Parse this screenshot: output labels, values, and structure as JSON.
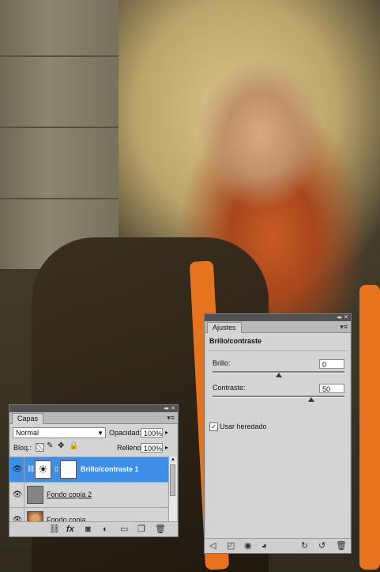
{
  "adjustments_panel": {
    "tab_label": "Ajustes",
    "title": "Brillo/contraste",
    "brightness_label": "Brillo:",
    "brightness_value": "0",
    "brightness_level": 0.5,
    "contrast_label": "Contraste:",
    "contrast_value": "50",
    "contrast_level": 0.75,
    "legacy_checkbox_label": "Usar heredado",
    "legacy_checked": true,
    "collapse_glyph": "◂◂",
    "close_glyph": "✕",
    "menu_glyph": "▾≡"
  },
  "layers_panel": {
    "tab_label": "Capas",
    "blend_mode": "Normal",
    "opacity_label": "Opacidad:",
    "opacity_value": "100%",
    "lock_label": "Bloq.:",
    "fill_label": "Relleno:",
    "fill_value": "100%",
    "layers": [
      {
        "name": "Brillo/contraste 1",
        "selected": true,
        "visible": true,
        "thumb": "brightness-adjustment"
      },
      {
        "name": "Fondo copia 2",
        "selected": false,
        "visible": true,
        "thumb": "gray-fill"
      },
      {
        "name": "Fondo copia",
        "selected": false,
        "visible": true,
        "thumb": "photo"
      }
    ],
    "bottom_icons": [
      "link-icon",
      "fx-icon",
      "mask-icon",
      "adjustment-icon",
      "group-icon",
      "new-layer-icon",
      "trash-icon"
    ]
  },
  "adjust_bottom_icons": [
    "back-icon",
    "clip-icon",
    "visibility-icon",
    "eye-icon",
    "previous-state-icon",
    "reset-icon",
    "trash-icon"
  ],
  "colors": {
    "selection": "#3d8ee6",
    "panel_bg": "#d4d4d4",
    "titlebar": "#525252"
  }
}
